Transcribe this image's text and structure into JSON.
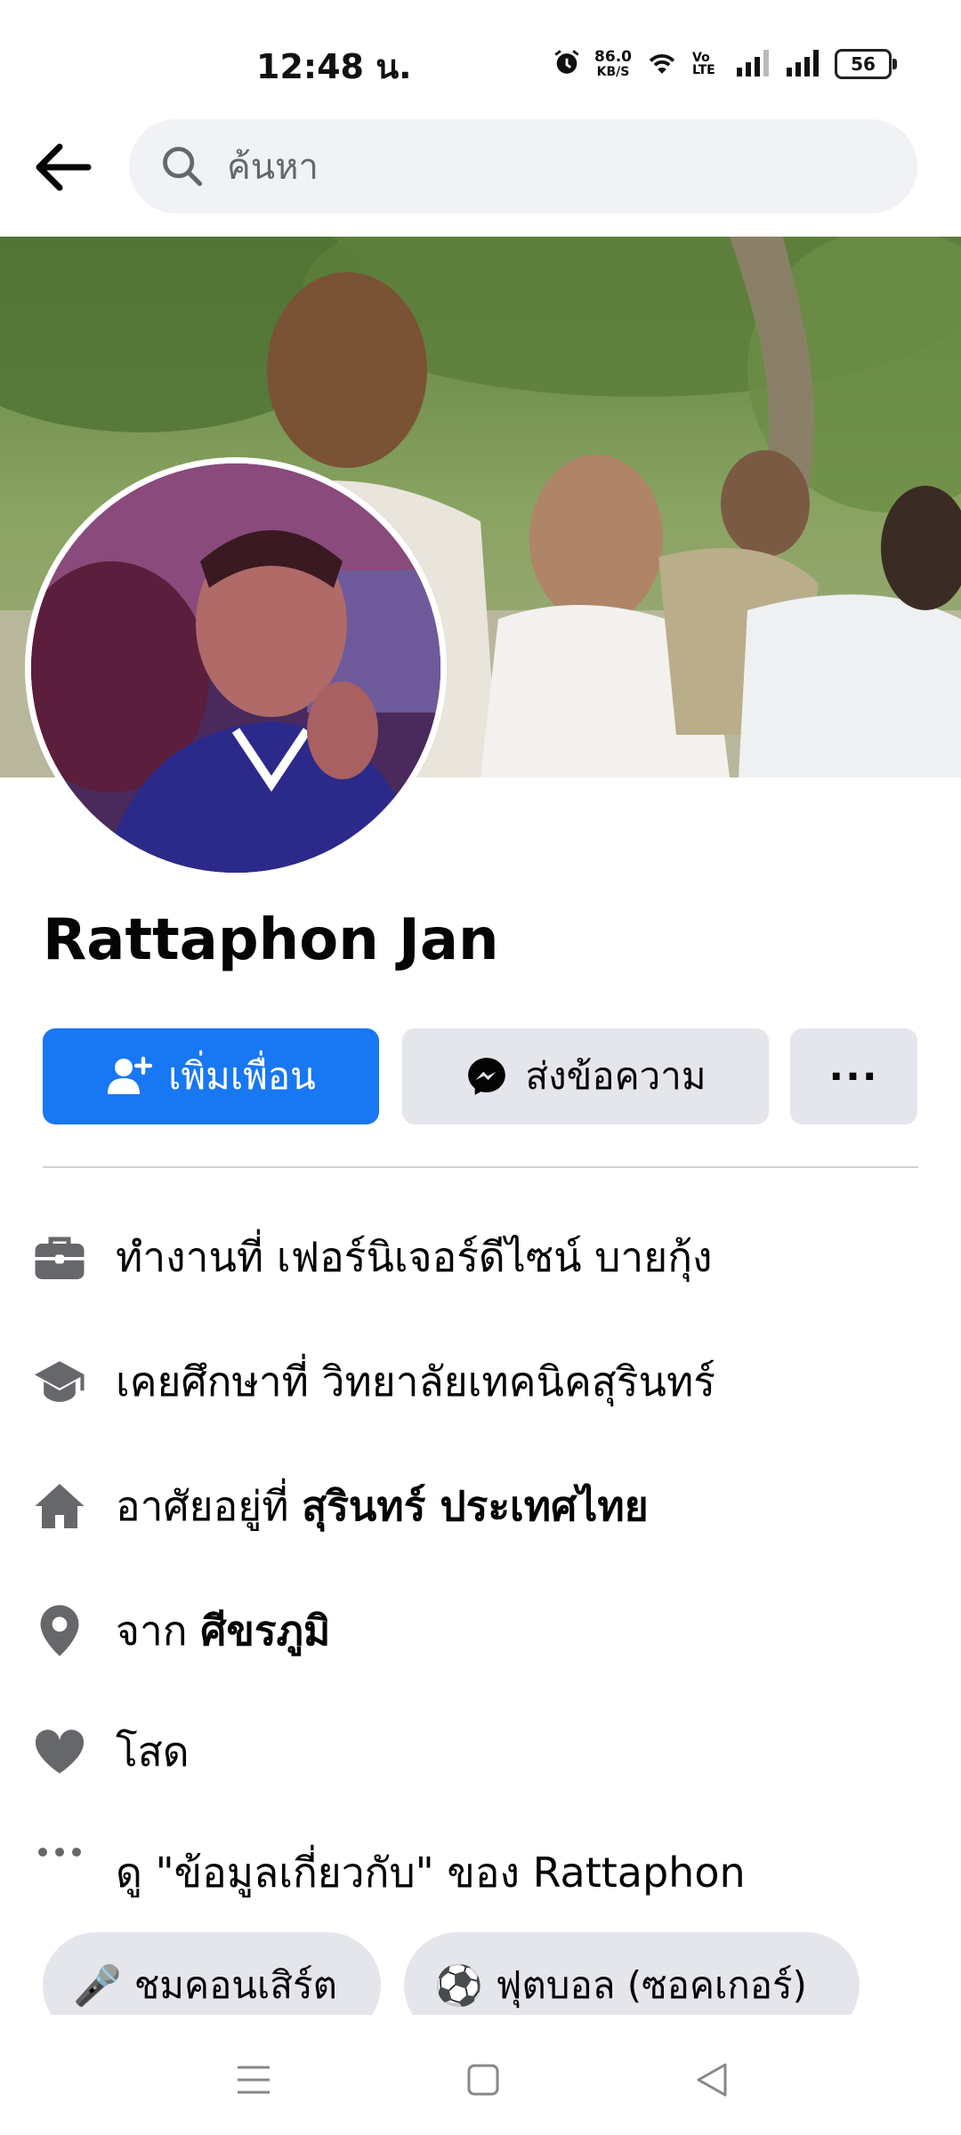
{
  "status_bar": {
    "time": "12:48 น.",
    "net_speed_value": "86.0",
    "net_speed_unit": "KB/S",
    "volte": "Vo LTE",
    "battery": "56"
  },
  "search": {
    "placeholder": "ค้นหา"
  },
  "profile": {
    "name": "Rattaphon Jan"
  },
  "actions": {
    "add_friend": "เพิ่มเพื่อน",
    "message": "ส่งข้อความ",
    "more": "···"
  },
  "details": {
    "work_prefix": "ทำงานที่ ",
    "work_value": "เฟอร์นิเจอร์ดีไซน์ บายกุ้ง",
    "education_prefix": "เคยศึกษาที่ ",
    "education_value": "วิทยาลัยเทคนิคสุรินทร์",
    "lives_prefix": "อาศัยอยู่ที่ ",
    "lives_value": "สุรินทร์ ประเทศไทย",
    "from_prefix": "จาก ",
    "from_value": "ศีขรภูมิ",
    "relationship": "โสด",
    "about_link": "ดู \"ข้อมูลเกี่ยวกับ\" ของ Rattaphon"
  },
  "interests": [
    {
      "emoji": "🎤",
      "label": "ชมคอนเสิร์ต"
    },
    {
      "emoji": "⚽",
      "label": "ฟุตบอล (ซอคเกอร์)"
    }
  ],
  "colors": {
    "primary": "#1877f2",
    "button_gray": "#e4e6eb",
    "search_bg": "#f0f2f5",
    "icon_gray": "#65676b"
  }
}
